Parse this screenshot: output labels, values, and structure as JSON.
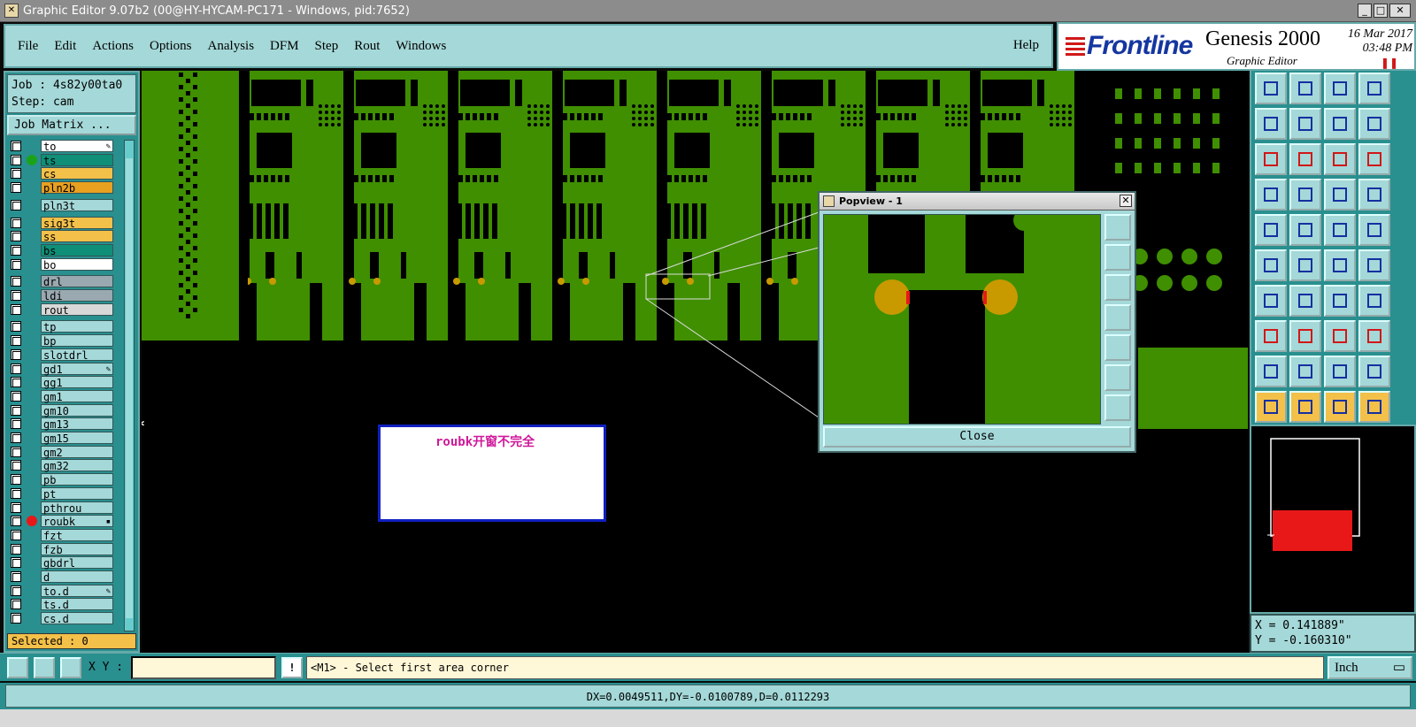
{
  "window": {
    "title": "Graphic Editor 9.07b2 (00@HY-HYCAM-PC171 - Windows, pid:7652)",
    "min": "_",
    "max": "□",
    "close": "✕"
  },
  "menu": {
    "items": [
      "File",
      "Edit",
      "Actions",
      "Options",
      "Analysis",
      "DFM",
      "Step",
      "Rout",
      "Windows"
    ],
    "help": "Help"
  },
  "brand": {
    "logo": "Frontline",
    "product": "Genesis 2000",
    "subtitle": "Graphic Editor",
    "date": "16 Mar 2017",
    "time": "03:48 PM"
  },
  "job": {
    "job": "Job : 4s82y00ta0",
    "step": "Step: cam",
    "matrix_button": "Job Matrix ..."
  },
  "layers": [
    {
      "name": "to",
      "color": "#ffffff",
      "dot": "",
      "mark": "✎"
    },
    {
      "name": "ts",
      "color": "#0f8f78",
      "dot": "#1aa31a",
      "mark": ""
    },
    {
      "name": "cs",
      "color": "#f3c04a",
      "dot": "",
      "mark": ""
    },
    {
      "name": "pln2b",
      "color": "#e8a020",
      "dot": "",
      "mark": ""
    },
    {
      "name": "pln3t",
      "color": "#a5d8d8",
      "dot": "",
      "mark": ""
    },
    {
      "name": "sig3t",
      "color": "#f3c04a",
      "dot": "",
      "mark": ""
    },
    {
      "name": "ss",
      "color": "#f3c04a",
      "dot": "",
      "mark": ""
    },
    {
      "name": "bs",
      "color": "#0f8f78",
      "dot": "",
      "mark": ""
    },
    {
      "name": "bo",
      "color": "#ffffff",
      "dot": "",
      "mark": ""
    },
    {
      "name": "drl",
      "color": "#9aa8b0",
      "dot": "",
      "mark": ""
    },
    {
      "name": "ldi",
      "color": "#9aa8b0",
      "dot": "",
      "mark": ""
    },
    {
      "name": "rout",
      "color": "#d8d8d8",
      "dot": "",
      "mark": ""
    },
    {
      "name": "tp",
      "color": "#a5d8d8",
      "dot": "",
      "mark": ""
    },
    {
      "name": "bp",
      "color": "#a5d8d8",
      "dot": "",
      "mark": ""
    },
    {
      "name": "slotdrl",
      "color": "#a5d8d8",
      "dot": "",
      "mark": ""
    },
    {
      "name": "gd1",
      "color": "#a5d8d8",
      "dot": "",
      "mark": "✎"
    },
    {
      "name": "gg1",
      "color": "#a5d8d8",
      "dot": "",
      "mark": ""
    },
    {
      "name": "gm1",
      "color": "#a5d8d8",
      "dot": "",
      "mark": ""
    },
    {
      "name": "gm10",
      "color": "#a5d8d8",
      "dot": "",
      "mark": ""
    },
    {
      "name": "gm13",
      "color": "#a5d8d8",
      "dot": "",
      "mark": ""
    },
    {
      "name": "gm15",
      "color": "#a5d8d8",
      "dot": "",
      "mark": ""
    },
    {
      "name": "gm2",
      "color": "#a5d8d8",
      "dot": "",
      "mark": ""
    },
    {
      "name": "gm32",
      "color": "#a5d8d8",
      "dot": "",
      "mark": ""
    },
    {
      "name": "pb",
      "color": "#a5d8d8",
      "dot": "",
      "mark": ""
    },
    {
      "name": "pt",
      "color": "#a5d8d8",
      "dot": "",
      "mark": ""
    },
    {
      "name": "pthrou",
      "color": "#a5d8d8",
      "dot": "",
      "mark": ""
    },
    {
      "name": "roubk",
      "color": "#a5d8d8",
      "dot": "#e81818",
      "mark": "▪"
    },
    {
      "name": "fzt",
      "color": "#a5d8d8",
      "dot": "",
      "mark": ""
    },
    {
      "name": "fzb",
      "color": "#a5d8d8",
      "dot": "",
      "mark": ""
    },
    {
      "name": "gbdrl",
      "color": "#a5d8d8",
      "dot": "",
      "mark": ""
    },
    {
      "name": "d",
      "color": "#a5d8d8",
      "dot": "",
      "mark": ""
    },
    {
      "name": "to.d",
      "color": "#a5d8d8",
      "dot": "",
      "mark": "✎"
    },
    {
      "name": "ts.d",
      "color": "#a5d8d8",
      "dot": "",
      "mark": ""
    },
    {
      "name": "cs.d",
      "color": "#a5d8d8",
      "dot": "",
      "mark": ""
    }
  ],
  "selected": "Selected : 0",
  "popview": {
    "title": "Popview - 1",
    "close": "Close"
  },
  "note": "roubk开窗不完全",
  "coords": {
    "x": "X = 0.141889\"",
    "y": "Y = -0.160310\""
  },
  "bottom": {
    "xy_label": "X Y :",
    "xy_value": "",
    "bang": "!",
    "prompt": "<M1> - Select first area corner",
    "unit": "Inch"
  },
  "status": "DX=0.0049511,DY=-0.0100789,D=0.0112293",
  "colors": {
    "copper": "#3f8f00",
    "pad": "#c89a00",
    "panel": "#a5d8d8",
    "dark_panel": "#2a8f8f"
  },
  "icons": [
    "zoom-in-icon",
    "zoom-out-icon",
    "home-icon",
    "fit-icon",
    "pan-left-icon",
    "pan-right-icon",
    "undo-view-icon",
    "redraw-icon",
    "expand-icon",
    "fit-vertical-icon",
    "scale-icon",
    "help-icon"
  ]
}
